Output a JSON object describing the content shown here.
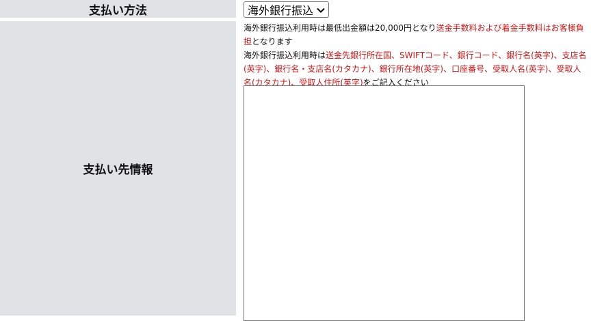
{
  "form": {
    "payment_method": {
      "label": "支払い方法",
      "selected": "海外銀行振込"
    },
    "payee_info": {
      "label": "支払い先情報",
      "note1_plain": "海外銀行振込利用時は最低出金額は20,000円となり",
      "note1_red": "送金手数料および着金手数料はお客様負担",
      "note1_tail": "となります",
      "note2_plain": "海外銀行振込利用時は",
      "note2_red": "送金先銀行所在国、SWIFTコード、銀行コード、銀行名(英字)、支店名(英字)、銀行名・支店名(カタカナ)、銀行所在地(英字)、口座番号、受取人名(英字)、受取人名(カタカナ)、受取人住所(英字)",
      "note2_tail": "をご記入ください",
      "textarea_value": ""
    }
  },
  "colors": {
    "label_bg": "#e1e2e5",
    "accent_red": "#d01414"
  },
  "icons": {
    "select_arrow": "chevron-down-icon"
  }
}
